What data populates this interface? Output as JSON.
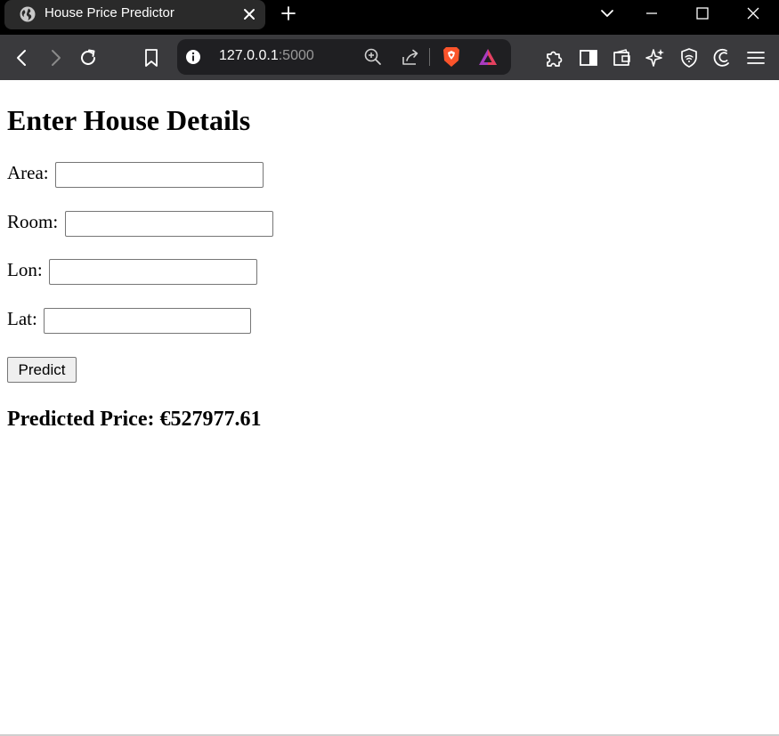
{
  "browser": {
    "tab": {
      "title": "House Price Predictor",
      "favicon": "globe-icon"
    },
    "url": {
      "host": "127.0.0.1",
      "port": ":5000"
    }
  },
  "page": {
    "heading": "Enter House Details",
    "fields": [
      {
        "label": "Area:",
        "value": ""
      },
      {
        "label": "Room:",
        "value": ""
      },
      {
        "label": "Lon:",
        "value": ""
      },
      {
        "label": "Lat:",
        "value": ""
      }
    ],
    "predict_label": "Predict",
    "result_text": "Predicted Price: €527977.61"
  },
  "colors": {
    "titlebar": "#000000",
    "tab": "#2a2a2a",
    "toolbar": "#3a3a3d",
    "urlbar": "#1f1f22",
    "brave_orange": "#fb542b"
  }
}
